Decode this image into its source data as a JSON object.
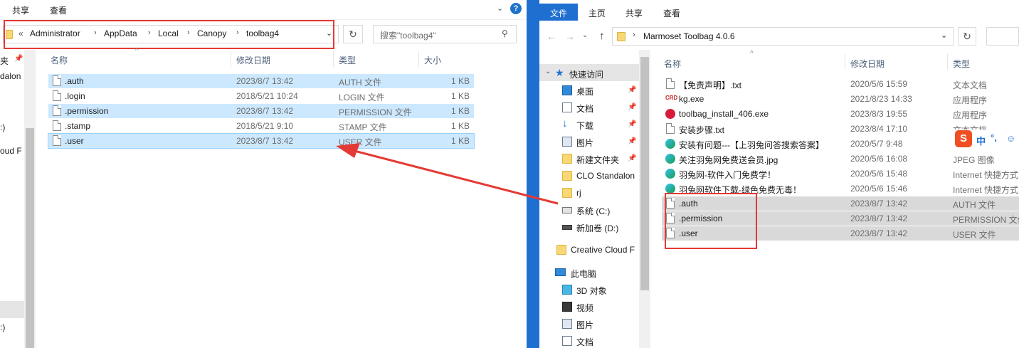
{
  "left": {
    "ribbon_tabs": [
      "共享",
      "查看"
    ],
    "left_edge_text": [
      "夹",
      "dalon",
      ":)",
      "oud F",
      ":)"
    ],
    "breadcrumb": [
      "«",
      "Administrator",
      "AppData",
      "Local",
      "Canopy",
      "toolbag4"
    ],
    "search_placeholder": "搜索\"toolbag4\"",
    "columns": [
      "名称",
      "修改日期",
      "类型",
      "大小"
    ],
    "files": [
      {
        "name": ".auth",
        "date": "2023/8/7 13:42",
        "type": "AUTH 文件",
        "size": "1 KB",
        "selected": true
      },
      {
        "name": ".login",
        "date": "2018/5/21 10:24",
        "type": "LOGIN 文件",
        "size": "1 KB",
        "selected": false
      },
      {
        "name": ".permission",
        "date": "2023/8/7 13:42",
        "type": "PERMISSION 文件",
        "size": "1 KB",
        "selected": true
      },
      {
        "name": ".stamp",
        "date": "2018/5/21 9:10",
        "type": "STAMP 文件",
        "size": "1 KB",
        "selected": false
      },
      {
        "name": ".user",
        "date": "2023/8/7 13:42",
        "type": "USER 文件",
        "size": "1 KB",
        "selected": true
      }
    ]
  },
  "right": {
    "ribbon_tabs": [
      "文件",
      "主页",
      "共享",
      "查看"
    ],
    "address": "Marmoset Toolbag 4.0.6",
    "columns": [
      "名称",
      "修改日期",
      "类型"
    ],
    "nav": [
      {
        "label": "快速访问",
        "icon": "star-icon",
        "pinned": false
      },
      {
        "label": "桌面",
        "icon": "desktop-icon",
        "pinned": true
      },
      {
        "label": "文档",
        "icon": "document-icon",
        "pinned": true
      },
      {
        "label": "下载",
        "icon": "download-icon",
        "pinned": true
      },
      {
        "label": "图片",
        "icon": "picture-icon",
        "pinned": true
      },
      {
        "label": "新建文件夹",
        "icon": "folder-icon",
        "pinned": true
      },
      {
        "label": "CLO Standalon",
        "icon": "folder-icon",
        "pinned": false
      },
      {
        "label": "rj",
        "icon": "folder-icon",
        "pinned": false
      },
      {
        "label": "系统 (C:)",
        "icon": "drive-icon",
        "pinned": false
      },
      {
        "label": "新加卷 (D:)",
        "icon": "drive-icon",
        "pinned": false
      },
      {
        "label": "Creative Cloud F",
        "icon": "creative-cloud-icon",
        "pinned": false
      },
      {
        "label": "此电脑",
        "icon": "computer-icon",
        "pinned": false
      },
      {
        "label": "3D 对象",
        "icon": "cube-icon",
        "pinned": false
      },
      {
        "label": "视频",
        "icon": "video-icon",
        "pinned": false
      },
      {
        "label": "图片",
        "icon": "picture-icon",
        "pinned": false
      },
      {
        "label": "文档",
        "icon": "document-icon",
        "pinned": false
      }
    ],
    "files": [
      {
        "name": "【免责声明】.txt",
        "date": "2020/5/6 15:59",
        "type": "文本文档",
        "icon": "text-file-icon"
      },
      {
        "name": "kg.exe",
        "date": "2021/8/23 14:33",
        "type": "应用程序",
        "icon": "crd-icon"
      },
      {
        "name": "toolbag_install_406.exe",
        "date": "2023/8/3 19:55",
        "type": "应用程序",
        "icon": "toolbag-icon"
      },
      {
        "name": "安装步骤.txt",
        "date": "2023/8/4 17:10",
        "type": "文本文档",
        "icon": "text-file-icon"
      },
      {
        "name": "安装有问题---【上羽兔问答搜索答案】",
        "date": "2020/5/7 9:48",
        "type": "I",
        "icon": "edge-icon"
      },
      {
        "name": "关注羽兔网免费送会员.jpg",
        "date": "2020/5/6 16:08",
        "type": "JPEG 图像",
        "icon": "image-icon"
      },
      {
        "name": "羽兔网-软件入门免费学！",
        "date": "2020/5/6 15:48",
        "type": "Internet 快捷方式",
        "icon": "edge-icon"
      },
      {
        "name": "羽兔网软件下载-绿色免费无毒！",
        "date": "2020/5/6 15:46",
        "type": "Internet 快捷方式",
        "icon": "edge-icon"
      },
      {
        "name": ".auth",
        "date": "2023/8/7 13:42",
        "type": "AUTH 文件",
        "icon": "file-icon"
      },
      {
        "name": ".permission",
        "date": "2023/8/7 13:42",
        "type": "PERMISSION 文件",
        "icon": "file-icon"
      },
      {
        "name": ".user",
        "date": "2023/8/7 13:42",
        "type": "USER 文件",
        "icon": "file-icon"
      }
    ],
    "ime_toolbar": [
      "S",
      "中",
      "°,",
      "☺"
    ]
  },
  "colors": {
    "selection": "#cce8ff",
    "highlight_box": "#e53935",
    "arrow": "#e53935",
    "divider": "#1f6fd1"
  }
}
